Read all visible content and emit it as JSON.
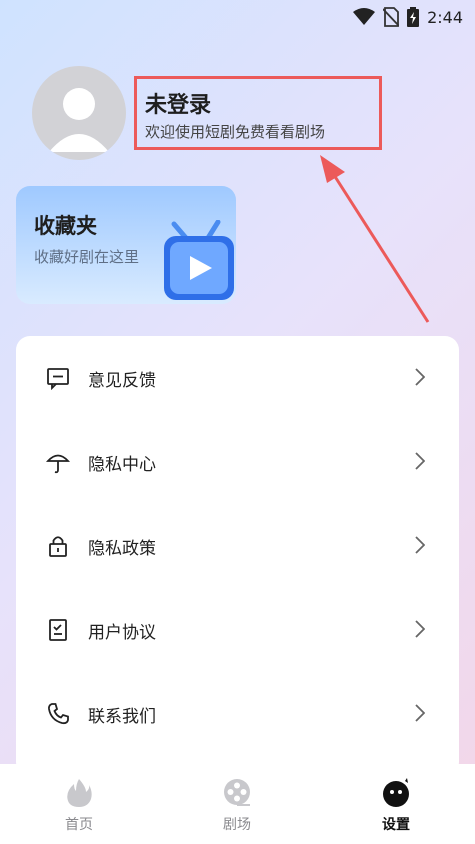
{
  "status_bar": {
    "time": "2:44",
    "icons": [
      "wifi-icon",
      "no-sim-icon",
      "battery-charging-icon"
    ]
  },
  "profile": {
    "avatar_icon": "user-avatar-icon",
    "title": "未登录",
    "subtitle": "欢迎使用短剧免费看看剧场",
    "highlight_color": "#ec5a5a"
  },
  "favorites": {
    "title": "收藏夹",
    "subtitle": "收藏好剧在这里",
    "icon": "tv-play-icon"
  },
  "menu": {
    "items": [
      {
        "label": "意见反馈",
        "icon": "feedback-icon"
      },
      {
        "label": "隐私中心",
        "icon": "umbrella-icon"
      },
      {
        "label": "隐私政策",
        "icon": "lock-icon"
      },
      {
        "label": "用户协议",
        "icon": "document-icon"
      },
      {
        "label": "联系我们",
        "icon": "phone-icon"
      }
    ]
  },
  "bottom_nav": {
    "items": [
      {
        "label": "首页",
        "icon": "flame-icon",
        "active": false
      },
      {
        "label": "剧场",
        "icon": "film-reel-icon",
        "active": false
      },
      {
        "label": "设置",
        "icon": "settings-face-icon",
        "active": true
      }
    ]
  }
}
